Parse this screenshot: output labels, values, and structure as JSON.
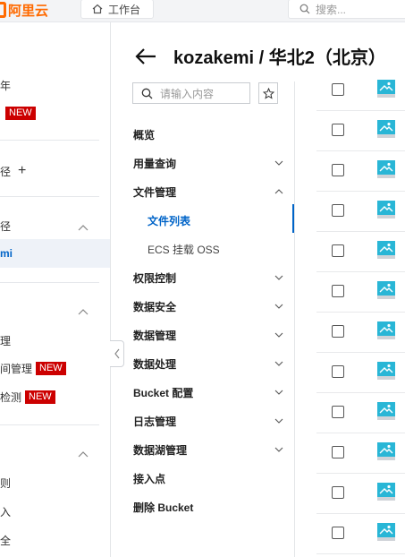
{
  "topbar": {
    "brand_text": "阿里云",
    "home_tab_label": "工作台",
    "search_placeholder": "搜索..."
  },
  "sidebar": {
    "items": [
      {
        "label": "年",
        "badge": ""
      },
      {
        "label": "",
        "badge": "NEW"
      },
      {
        "label": "径",
        "badge": "",
        "add": "+"
      },
      {
        "label": "径",
        "badge": ""
      },
      {
        "label": "mi",
        "badge": ""
      },
      {
        "label": "理",
        "badge": ""
      },
      {
        "label": "间管理",
        "badge": "NEW"
      },
      {
        "label": "检测",
        "badge": "NEW"
      },
      {
        "label": "则",
        "badge": ""
      },
      {
        "label": "入",
        "badge": ""
      },
      {
        "label": "全",
        "badge": ""
      }
    ]
  },
  "header": {
    "title": "kozakemi / 华北2（北京）"
  },
  "menu": {
    "search_placeholder": "请输入内容",
    "items": [
      {
        "label": "概览"
      },
      {
        "label": "用量查询"
      },
      {
        "label": "文件管理"
      },
      {
        "label": "文件列表"
      },
      {
        "label": "ECS 挂载 OSS"
      },
      {
        "label": "权限控制"
      },
      {
        "label": "数据安全"
      },
      {
        "label": "数据管理"
      },
      {
        "label": "数据处理"
      },
      {
        "label": "Bucket 配置"
      },
      {
        "label": "日志管理"
      },
      {
        "label": "数据湖管理"
      },
      {
        "label": "接入点"
      },
      {
        "label": "删除 Bucket"
      }
    ]
  },
  "colors": {
    "brand": "#ff6a00",
    "accent": "#0064c8",
    "badge": "#cc0000",
    "file_icon": "#29b6d6"
  },
  "file_rows_count": 12
}
